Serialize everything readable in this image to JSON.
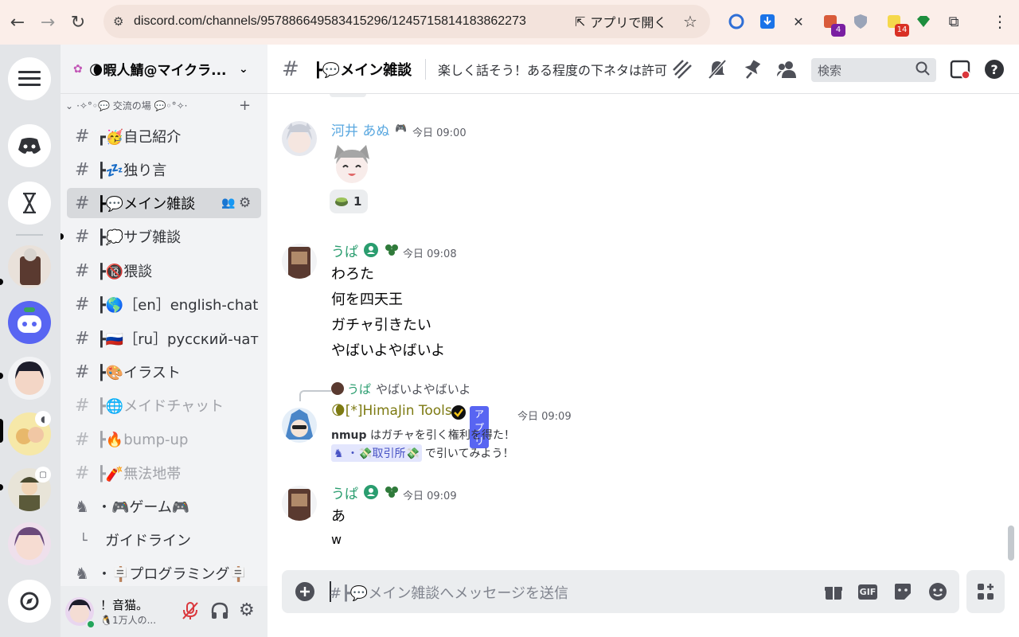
{
  "browser": {
    "url": "discord.com/channels/957886649583415296/1245715814183862273",
    "open_app_label": "アプリで開く",
    "ext_badges": [
      "4",
      "14"
    ]
  },
  "server": {
    "name": "🌘暇人鯖@マイクラ..."
  },
  "sidebar": {
    "category": "·✧°◦💬 交流の場 💬◦°✧·",
    "channels": [
      {
        "label": "┏🥳自己紹介",
        "kind": "text"
      },
      {
        "label": "┣💤独り言",
        "kind": "text"
      },
      {
        "label": "┣💬メイン雑談",
        "kind": "text"
      },
      {
        "label": "┣💭サブ雑談",
        "kind": "text"
      },
      {
        "label": "┣🔞猥談",
        "kind": "text"
      },
      {
        "label": "┣🌎［en］english-chat",
        "kind": "text"
      },
      {
        "label": "┣🇷🇺［ru］русский-чат",
        "kind": "text"
      },
      {
        "label": "┣🎨イラスト",
        "kind": "text"
      },
      {
        "label": "┣🌐メイドチャット",
        "kind": "muted"
      },
      {
        "label": "┣🔥bump-up",
        "kind": "muted"
      },
      {
        "label": "┣🧨無法地帯",
        "kind": "muted"
      },
      {
        "label": "・🎮ゲーム🎮",
        "kind": "forum"
      },
      {
        "label": "ガイドライン",
        "kind": "thread"
      },
      {
        "label": "・🪧プログラミング🪧",
        "kind": "forum"
      }
    ]
  },
  "user": {
    "name": "！音猫。",
    "status": "🐧1万人の..."
  },
  "channel": {
    "name": "┣💬メイン雑談",
    "topic": "楽しく話そう！ある程度の下ネタは許可",
    "search_placeholder": "検索"
  },
  "messages": [
    {
      "author": "河井 あぬ",
      "time": "今日 09:00",
      "reaction_count": "1"
    },
    {
      "author": "うぱ",
      "time": "今日 09:08",
      "lines": [
        "わろた",
        "何を四天王",
        "ガチャ引きたい",
        "やばいよやばいよ"
      ]
    },
    {
      "reply_author": "うぱ",
      "reply_text": "やばいよやばいよ",
      "author": "🌘[*]HimaJin Tools",
      "app_tag": "アプリ",
      "time": "今日 09:09",
      "bold_user": "nmup",
      "text1": "はガチャを引く権利を得た！",
      "channel_link": "・💸取引所💸",
      "text2": "で引いてみよう！"
    },
    {
      "author": "うぱ",
      "time": "今日 09:09",
      "lines": [
        "あ",
        "w"
      ]
    }
  ],
  "composer": {
    "placeholder": "#┣💬メイン雑談へメッセージを送信",
    "gif_label": "GIF"
  },
  "colors": {
    "anu": "#5aa8e0",
    "upa": "#2a9d6f",
    "himajin": "#7d7a12",
    "app_tag": "#5865f2"
  }
}
